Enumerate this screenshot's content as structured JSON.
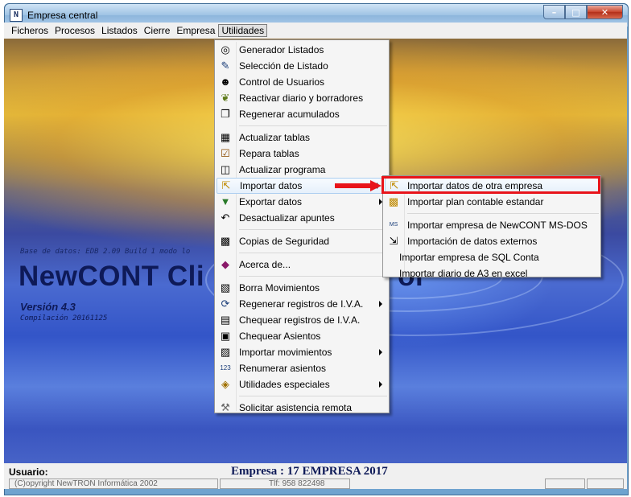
{
  "window": {
    "title": "Empresa central"
  },
  "menubar": [
    {
      "label": "Ficheros"
    },
    {
      "label": "Procesos"
    },
    {
      "label": "Listados"
    },
    {
      "label": "Cierre"
    },
    {
      "label": "Empresa"
    },
    {
      "label": "Utilidades",
      "active": true
    }
  ],
  "background": {
    "db_line": "Base de datos: EDB 2.09 Build 1 modo lo",
    "app_name": "NewCONT Cli",
    "app_name_tail": "or",
    "version": "Versión 4.3",
    "build": "Compilación 20161125"
  },
  "utilidades_menu": {
    "items": [
      {
        "label": "Generador Listados",
        "icon": "binoculars-icon"
      },
      {
        "label": "Selección de Listado",
        "icon": "list-search-icon"
      },
      {
        "label": "Control de Usuarios",
        "icon": "users-icon"
      },
      {
        "label": "Reactivar diario y borradores",
        "icon": "broom-icon"
      },
      {
        "label": "Regenerar acumulados",
        "icon": "copy-icon"
      },
      {
        "label": "Actualizar tablas",
        "icon": "table-icon"
      },
      {
        "label": "Repara tablas",
        "icon": "clipboard-check-icon"
      },
      {
        "label": "Actualizar programa",
        "icon": "window-icon"
      },
      {
        "label": "Importar datos",
        "icon": "import-icon",
        "highlighted": true,
        "submenu": true
      },
      {
        "label": "Exportar datos",
        "icon": "export-icon",
        "submenu": true
      },
      {
        "label": "Desactualizar apuntes",
        "icon": "undo-icon"
      },
      {
        "label": "Copias de Seguridad",
        "icon": "backup-icon"
      },
      {
        "label": "Acerca de...",
        "icon": "gem-icon"
      },
      {
        "label": "Borra Movimientos",
        "icon": "trash-icon"
      },
      {
        "label": "Regenerar registros de I.V.A.",
        "icon": "refresh-icon",
        "submenu": true
      },
      {
        "label": "Chequear registros de I.V.A.",
        "icon": "check-register-icon"
      },
      {
        "label": "Chequear Asientos",
        "icon": "check-entries-icon"
      },
      {
        "label": "Importar movimientos",
        "icon": "import-moves-icon",
        "submenu": true
      },
      {
        "label": "Renumerar asientos",
        "icon": "renumber-icon"
      },
      {
        "label": "Utilidades especiales",
        "icon": "special-icon",
        "submenu": true
      },
      {
        "label": "Solicitar asistencia remota",
        "icon": "tools-icon"
      }
    ]
  },
  "importar_submenu": {
    "items": [
      {
        "label": "Importar datos de otra empresa",
        "icon": "import-company-icon",
        "highlighted": true
      },
      {
        "label": "Importar plan contable estandar",
        "icon": "import-plan-icon"
      },
      {
        "label": "Importar empresa de NewCONT MS-DOS",
        "icon": "msdos-icon"
      },
      {
        "label": "Importación de datos externos",
        "icon": "external-data-icon"
      },
      {
        "label": "Importar empresa de SQL Conta"
      },
      {
        "label": "Importar diario de A3 en excel"
      }
    ]
  },
  "statusbar": {
    "usuario": "Usuario:",
    "empresa": "Empresa : 17 EMPRESA 2017",
    "copyright": "(C)opyright NewTRON Informática 2002",
    "tlf": "Tlf: 958 822498"
  },
  "colors": {
    "highlight_box": "#e8141a",
    "menu_bg": "#f5f5f5",
    "title_text": "#0e1a58"
  }
}
